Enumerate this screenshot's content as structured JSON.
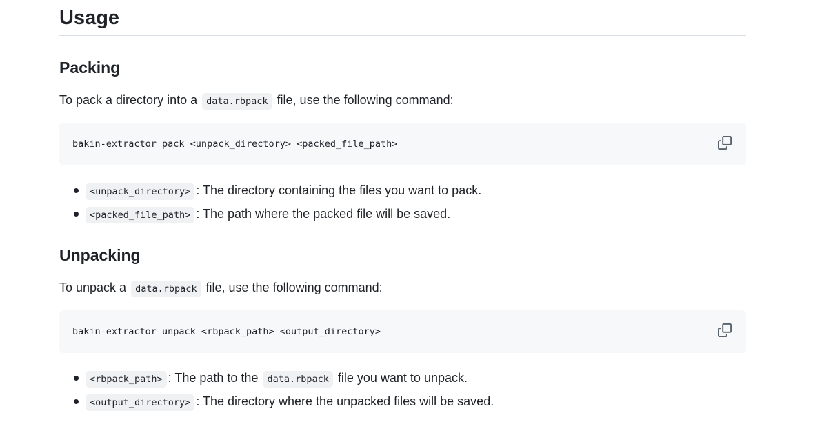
{
  "usage": {
    "title": "Usage"
  },
  "packing": {
    "title": "Packing",
    "intro_before": "To pack a directory into a",
    "intro_code": "data.rbpack",
    "intro_after": "file, use the following command:",
    "command": "bakin-extractor pack <unpack_directory> <packed_file_path>",
    "copy_icon": "copy-icon",
    "params": [
      {
        "code": "<unpack_directory>",
        "desc": ": The directory containing the files you want to pack."
      },
      {
        "code": "<packed_file_path>",
        "desc": ": The path where the packed file will be saved."
      }
    ]
  },
  "unpacking": {
    "title": "Unpacking",
    "intro_before": "To unpack a",
    "intro_code": "data.rbpack",
    "intro_after": "file, use the following command:",
    "command": "bakin-extractor unpack <rbpack_path> <output_directory>",
    "copy_icon": "copy-icon",
    "params": [
      {
        "code": "<rbpack_path>",
        "desc_before": ": The path to the",
        "desc_code": "data.rbpack",
        "desc_after": "file you want to unpack."
      },
      {
        "code": "<output_directory>",
        "desc": ": The directory where the unpacked files will be saved."
      }
    ]
  }
}
